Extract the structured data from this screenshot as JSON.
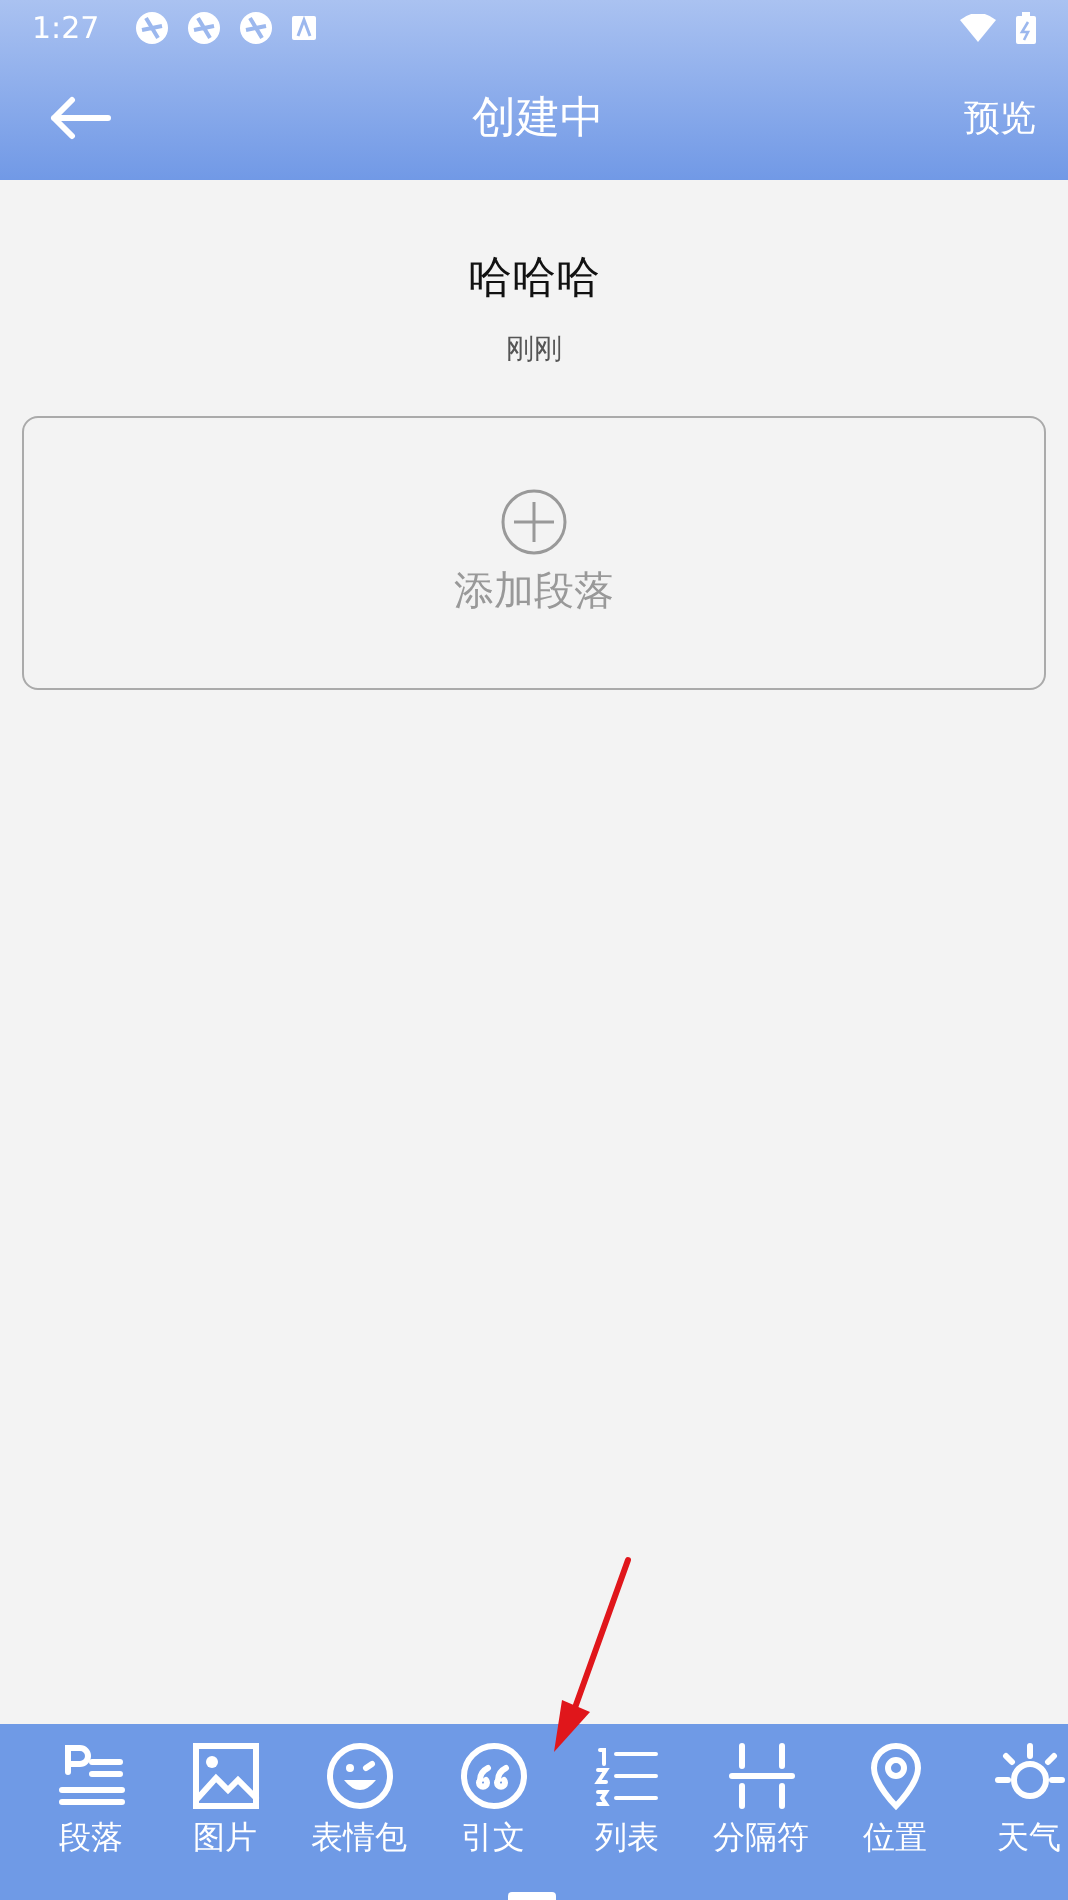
{
  "status_bar": {
    "time": "1:27"
  },
  "header": {
    "title": "创建中",
    "action": "预览"
  },
  "document": {
    "title": "哈哈哈",
    "time": "刚刚"
  },
  "add_paragraph": {
    "label": "添加段落"
  },
  "toolbar": {
    "items": [
      {
        "kind": "paragraph",
        "label": "段落"
      },
      {
        "kind": "image",
        "label": "图片"
      },
      {
        "kind": "emoji",
        "label": "表情包"
      },
      {
        "kind": "quote",
        "label": "引文"
      },
      {
        "kind": "list",
        "label": "列表"
      },
      {
        "kind": "divider",
        "label": "分隔符"
      },
      {
        "kind": "location",
        "label": "位置"
      },
      {
        "kind": "weather",
        "label": "天气"
      }
    ]
  }
}
